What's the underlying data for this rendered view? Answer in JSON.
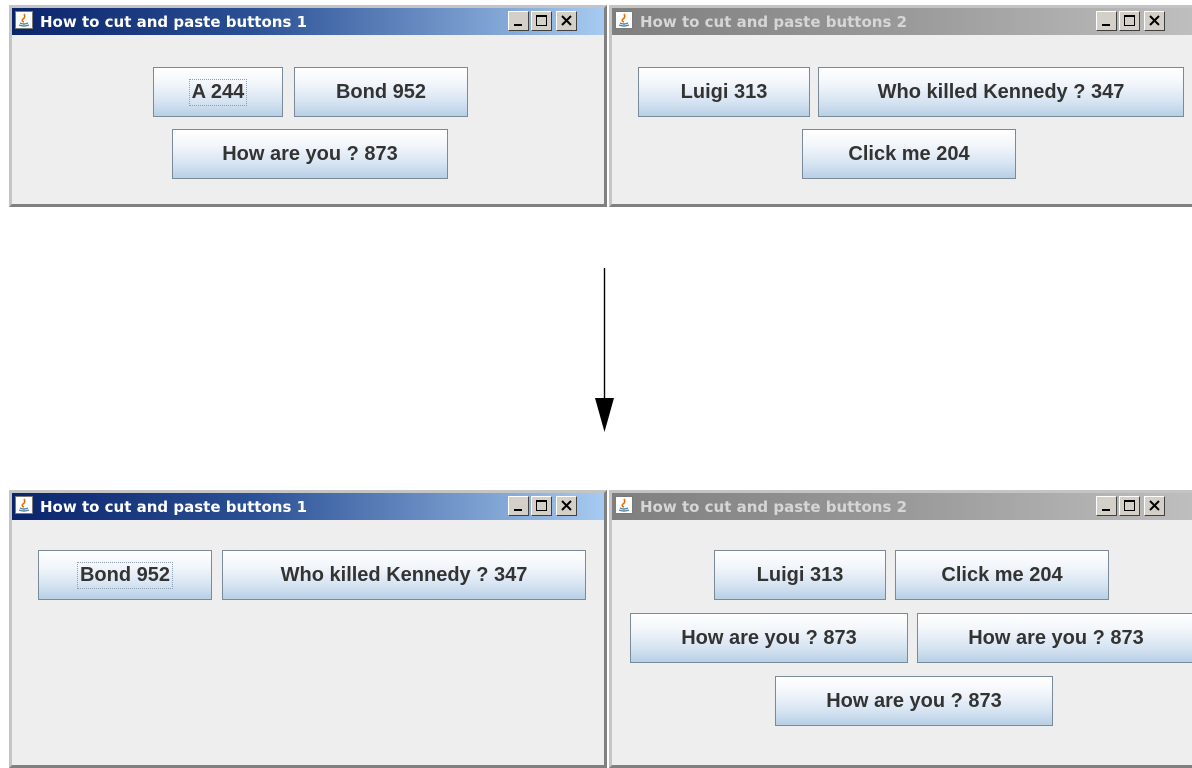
{
  "top": {
    "win1": {
      "title": "How to cut and paste buttons 1",
      "buttons": [
        {
          "label": "A 244"
        },
        {
          "label": "Bond 952"
        },
        {
          "label": "How are you ? 873"
        }
      ]
    },
    "win2": {
      "title": "How to cut and paste buttons 2",
      "buttons": [
        {
          "label": "Luigi 313"
        },
        {
          "label": "Who killed Kennedy ? 347"
        },
        {
          "label": "Click me 204"
        }
      ]
    }
  },
  "bottom": {
    "win1": {
      "title": "How to cut and paste buttons 1",
      "buttons": [
        {
          "label": "Bond 952"
        },
        {
          "label": "Who killed Kennedy ? 347"
        }
      ]
    },
    "win2": {
      "title": "How to cut and paste buttons 2",
      "buttons": [
        {
          "label": "Luigi 313"
        },
        {
          "label": "Click me 204"
        },
        {
          "label": "How are you ? 873"
        },
        {
          "label": "How are you ? 873"
        },
        {
          "label": "How are you ? 873"
        }
      ]
    }
  },
  "colors": {
    "titlebar_active": "#0a246a",
    "titlebar_inactive": "#808080",
    "window_bg": "#eeeeee"
  },
  "icons": [
    "java-icon",
    "minimize-icon",
    "maximize-icon",
    "close-icon",
    "down-arrow-icon"
  ]
}
